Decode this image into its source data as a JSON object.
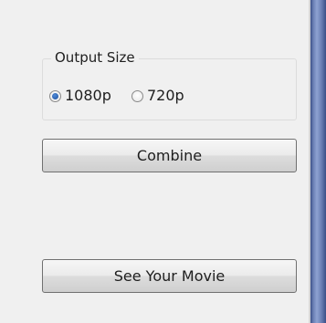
{
  "output_size": {
    "legend": "Output Size",
    "options": [
      {
        "label": "1080p",
        "checked": true
      },
      {
        "label": "720p",
        "checked": false
      }
    ]
  },
  "buttons": {
    "combine": "Combine",
    "see_movie": "See Your Movie"
  },
  "colors": {
    "panel": "#f0f0f0",
    "radio_dot": "#1b4f9c",
    "scrollbar": "#6a7fb4"
  }
}
